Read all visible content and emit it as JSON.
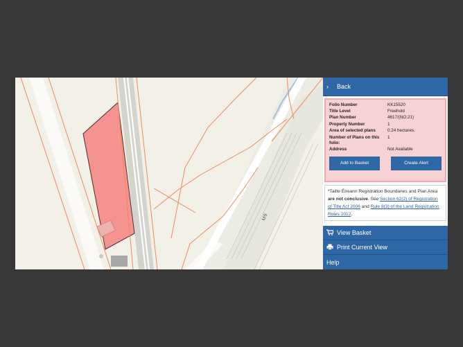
{
  "panel": {
    "back_label": "Back",
    "info_rows": [
      {
        "key": "Folio Number",
        "value": "KK15520"
      },
      {
        "key": "Title Level",
        "value": "Freehold"
      },
      {
        "key": "Plan Number",
        "value": "4617/(NO.21)"
      },
      {
        "key": "Property Number",
        "value": "1"
      },
      {
        "key": "Area of selected plans",
        "value": "0.24 hectares."
      },
      {
        "key": "Number of Plans on this folio:",
        "value": "1"
      },
      {
        "key": "Address",
        "value": "Not Available"
      }
    ],
    "add_to_basket_label": "Add to Basket",
    "create_alert_label": "Create Alert",
    "notice": {
      "intro": "*Tailte Éireann Registration Boundaries and Plan Area ",
      "bold": "are not conclusive",
      "see": ". See ",
      "link1": "Section 62(2) of Registration of Title Act 2006",
      "and": " and ",
      "link2": "Rule 8(3) of the Land Registration Rules 2012",
      "end": "."
    },
    "view_basket_label": "View Basket",
    "print_label": "Print Current View",
    "help_label": "Help"
  },
  "map": {
    "road_label": "M9",
    "highlight_color": "#f4938f",
    "boundary_color": "#ee8a5a"
  }
}
